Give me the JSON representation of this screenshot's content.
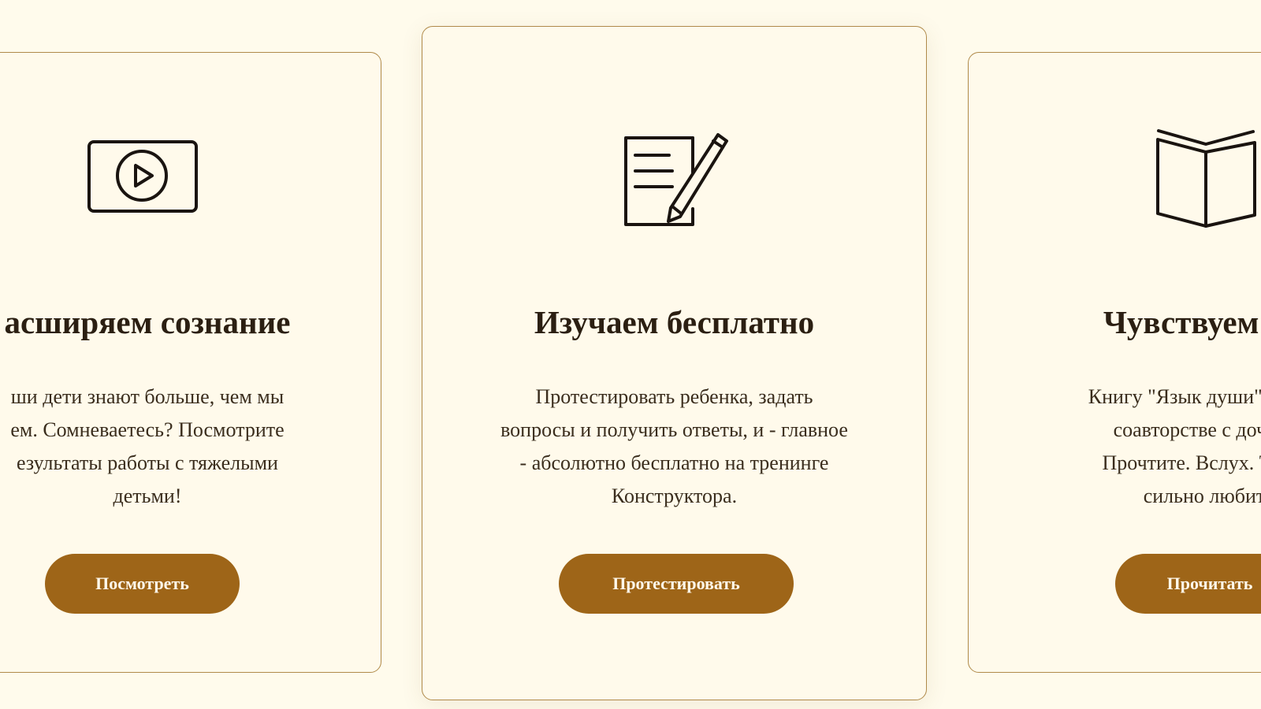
{
  "colors": {
    "background": "#fffbec",
    "card_border": "#b08a4a",
    "button": "#9e6518",
    "text": "#2b1f12"
  },
  "cards": [
    {
      "icon": "video-play-icon",
      "title": "асширяем сознание",
      "text": "ши дети знают больше, чем мы ем. Сомневаетесь? Посмотрите езультаты работы с тяжелыми детьми!",
      "text_lines": [
        "ши дети знают больше, чем мы",
        "ем. Сомневаетесь? Посмотрите",
        "езультаты работы с тяжелыми",
        "детьми!"
      ],
      "button": "Посмотреть"
    },
    {
      "icon": "document-pencil-icon",
      "title": "Изучаем бесплатно",
      "text_lines": [
        "Протестировать ребенка, задать",
        "вопросы и получить ответы, и - главное",
        "- абсолютно бесплатно на тренинге",
        "Конструктора."
      ],
      "button": "Протестировать"
    },
    {
      "icon": "open-book-icon",
      "title": "Чувствуем му",
      "text_lines": [
        "Книгу \"Язык души\" Галин",
        "соавторстве с дочерь",
        "Прочтите. Вслух. Тому,",
        "сильно любит"
      ],
      "button": "Прочитать"
    }
  ]
}
